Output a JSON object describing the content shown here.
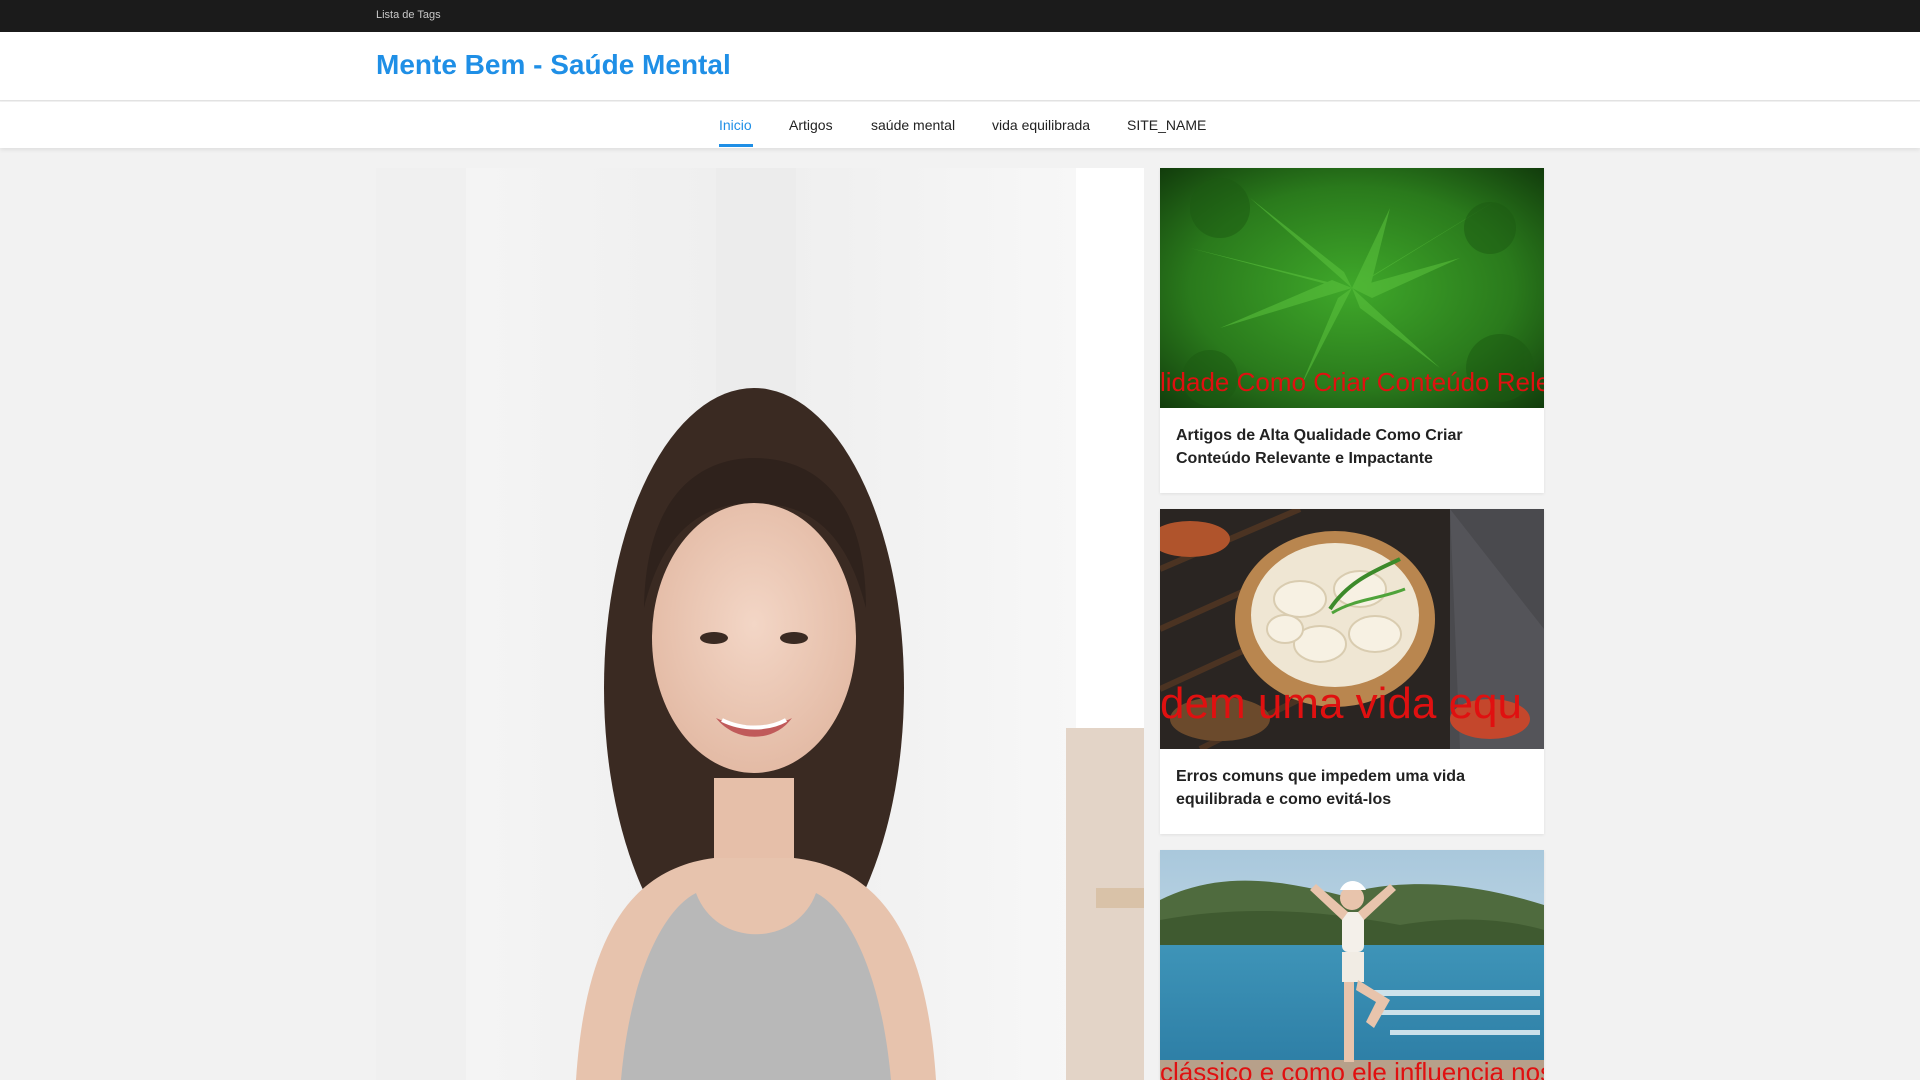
{
  "topbar": {
    "tags_link": "Lista de Tags"
  },
  "header": {
    "site_title": "Mente Bem - Saúde Mental"
  },
  "nav": {
    "items": [
      {
        "label": "Inicio",
        "active": true
      },
      {
        "label": "Artigos",
        "active": false
      },
      {
        "label": "saúde mental",
        "active": false
      },
      {
        "label": "vida equilibrada",
        "active": false
      },
      {
        "label": "SITE_NAME",
        "active": false
      }
    ]
  },
  "cards": [
    {
      "title": "Artigos de Alta Qualidade Como Criar Conteúdo Relevante e Impactante",
      "overlay": "lidade Como Criar Conteúdo Rele"
    },
    {
      "title": "Erros comuns que impedem uma vida equilibrada e como evitá-los",
      "overlay": "dem uma vida equ"
    },
    {
      "title": "",
      "overlay": "clássico e como ele influencia noss"
    }
  ],
  "colors": {
    "accent": "#1f8fe6",
    "overlay_text": "#e01010",
    "topbar": "#1b1b1b"
  }
}
